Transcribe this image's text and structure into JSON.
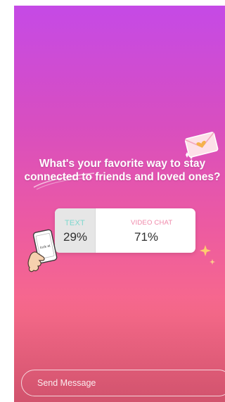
{
  "story": {
    "background_top": "#c54ae6",
    "background_bottom": "#f2637c"
  },
  "question": {
    "text": "What's your favorite way to stay connected to friends and loved ones?"
  },
  "poll": {
    "options": [
      {
        "label": "TEXT",
        "percent": "29%",
        "label_color": "#7fd8cf"
      },
      {
        "label": "VIDEO CHAT",
        "percent": "71%",
        "label_color": "#ef86a8"
      }
    ]
  },
  "sticker": {
    "phone_text": "look at"
  },
  "message_bar": {
    "placeholder": "Send Message"
  }
}
